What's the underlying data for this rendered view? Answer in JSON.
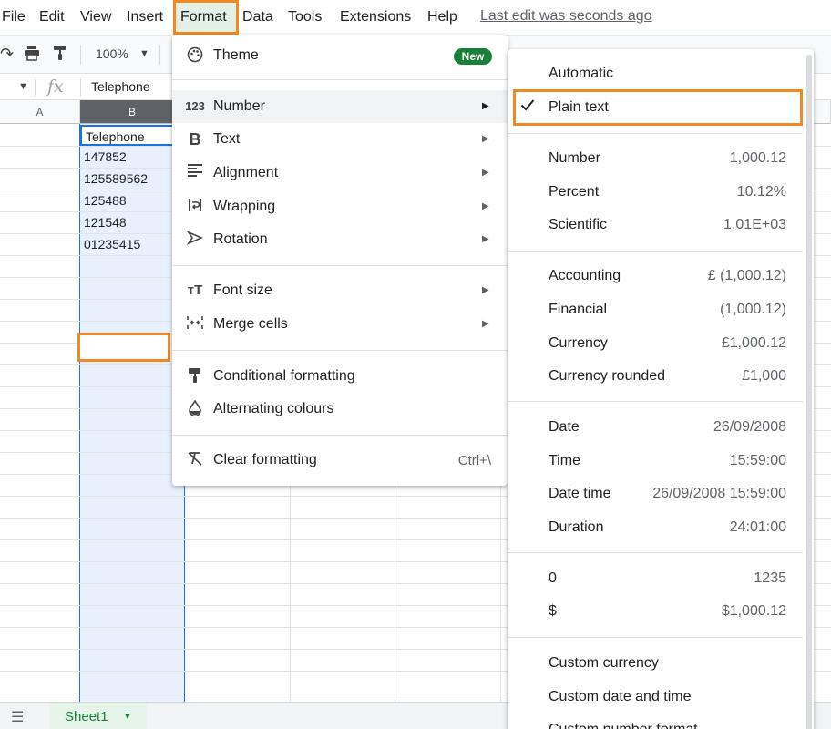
{
  "menubar": {
    "items": [
      "File",
      "Edit",
      "View",
      "Insert",
      "Format",
      "Data",
      "Tools",
      "Extensions",
      "Help"
    ],
    "last_edit": "Last edit was seconds ago"
  },
  "toolbar": {
    "zoom": "100%",
    "icons": [
      "redo-icon",
      "print-icon",
      "paint-format-icon"
    ]
  },
  "formula_bar": {
    "fx": "fx",
    "content": "Telephone"
  },
  "grid": {
    "columns": [
      "A",
      "B"
    ],
    "selected_column": "B",
    "cells_b": [
      "Telephone",
      "147852",
      "125589562",
      "125488",
      "121548",
      "01235415"
    ]
  },
  "sheet": {
    "name": "Sheet1"
  },
  "format_menu": {
    "theme": "Theme",
    "new_badge": "New",
    "number": "Number",
    "text": "Text",
    "alignment": "Alignment",
    "wrapping": "Wrapping",
    "rotation": "Rotation",
    "font_size": "Font size",
    "merge_cells": "Merge cells",
    "conditional_formatting": "Conditional formatting",
    "alternating_colours": "Alternating colours",
    "clear_formatting": "Clear formatting",
    "clear_shortcut": "Ctrl+\\",
    "number_icon_text": "123"
  },
  "number_submenu": {
    "automatic": "Automatic",
    "plain_text": "Plain text",
    "groups": [
      [
        {
          "label": "Number",
          "example": "1,000.12"
        },
        {
          "label": "Percent",
          "example": "10.12%"
        },
        {
          "label": "Scientific",
          "example": "1.01E+03"
        }
      ],
      [
        {
          "label": "Accounting",
          "example": "£ (1,000.12)"
        },
        {
          "label": "Financial",
          "example": "(1,000.12)"
        },
        {
          "label": "Currency",
          "example": "£1,000.12"
        },
        {
          "label": "Currency rounded",
          "example": "£1,000"
        }
      ],
      [
        {
          "label": "Date",
          "example": "26/09/2008"
        },
        {
          "label": "Time",
          "example": "15:59:00"
        },
        {
          "label": "Date time",
          "example": "26/09/2008 15:59:00"
        },
        {
          "label": "Duration",
          "example": "24:01:00"
        }
      ],
      [
        {
          "label": "0",
          "example": "1235"
        },
        {
          "label": "$",
          "example": "$1,000.12"
        }
      ]
    ],
    "custom_currency": "Custom currency",
    "custom_date_time": "Custom date and time",
    "custom_number_format": "Custom number format"
  },
  "colors": {
    "highlight": "#f08a24",
    "selection_blue": "#1a73e8",
    "badge_green": "#188038"
  }
}
